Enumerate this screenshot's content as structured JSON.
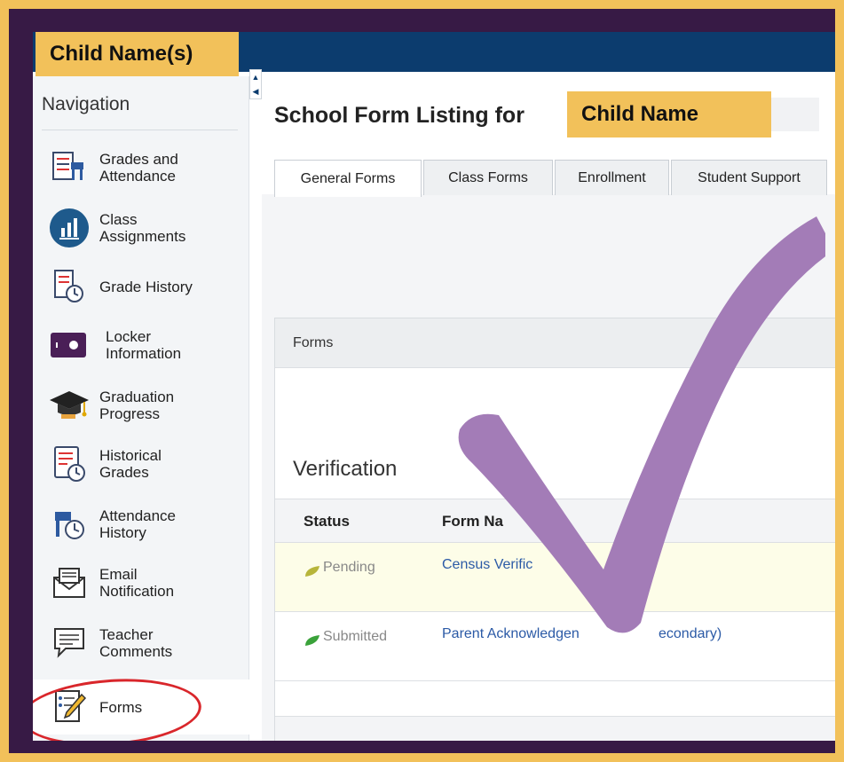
{
  "header": {
    "child_tab": "Child Name(s)"
  },
  "sidebar": {
    "title": "Navigation",
    "items": [
      {
        "label": "Grades and\nAttendance",
        "icon": "grades-attendance-icon"
      },
      {
        "label": "Class\nAssignments",
        "icon": "class-assignments-icon"
      },
      {
        "label": "Grade History",
        "icon": "grade-history-icon"
      },
      {
        "label": "Locker\nInformation",
        "icon": "locker-icon"
      },
      {
        "label": "Graduation\nProgress",
        "icon": "graduation-cap-icon"
      },
      {
        "label": "Historical\nGrades",
        "icon": "historical-grades-icon"
      },
      {
        "label": "Attendance\nHistory",
        "icon": "attendance-history-icon"
      },
      {
        "label": "Email\nNotification",
        "icon": "email-icon"
      },
      {
        "label": "Teacher\nComments",
        "icon": "speech-bubble-icon"
      },
      {
        "label": "Forms",
        "icon": "forms-pencil-icon"
      }
    ],
    "active_item": "Forms"
  },
  "main": {
    "title_prefix": "School Form Listing for",
    "child_badge": "Child Name",
    "tabs": [
      "General Forms",
      "Class Forms",
      "Enrollment",
      "Student Support"
    ],
    "active_tab": "General Forms",
    "panel_title": "Forms",
    "section_title": "Verification",
    "table": {
      "columns": [
        "Status",
        "Form Na"
      ],
      "rows": [
        {
          "status": "Pending",
          "form": "Census Verific"
        },
        {
          "status": "Submitted",
          "form": "Parent Acknowledgen"
        }
      ],
      "row2_suffix": "econdary)"
    }
  },
  "colors": {
    "frame": "#f2c15a",
    "background": "#371a45",
    "topbar": "#0c3c6e",
    "checkmark": "#a37cb7",
    "link": "#2b5aa6",
    "highlight_circle": "#d9262b"
  }
}
